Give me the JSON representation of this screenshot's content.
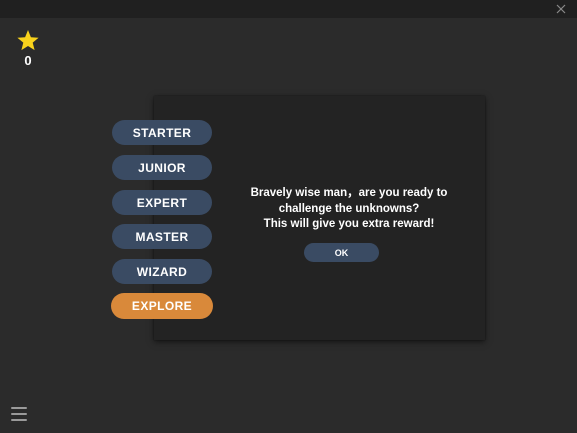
{
  "window": {
    "close_icon": "close-icon"
  },
  "score": {
    "icon": "star-icon",
    "star_color": "#f8d21c",
    "value": "0"
  },
  "levels": [
    {
      "label": "STARTER",
      "active": false
    },
    {
      "label": "JUNIOR",
      "active": false
    },
    {
      "label": "EXPERT",
      "active": false
    },
    {
      "label": "MASTER",
      "active": false
    },
    {
      "label": "WIZARD",
      "active": false
    },
    {
      "label": "EXPLORE",
      "active": true
    }
  ],
  "dialog": {
    "lines": [
      "Bravely wise man，are you ready to",
      "challenge the unknowns?",
      "This will give you extra reward!"
    ],
    "ok_label": "OK"
  },
  "menu": {
    "icon": "hamburger-menu-icon"
  },
  "colors": {
    "background": "#2b2b2b",
    "panel": "#232323",
    "button": "#3a4b63",
    "active_button": "#d9893a",
    "text": "#ffffff"
  }
}
